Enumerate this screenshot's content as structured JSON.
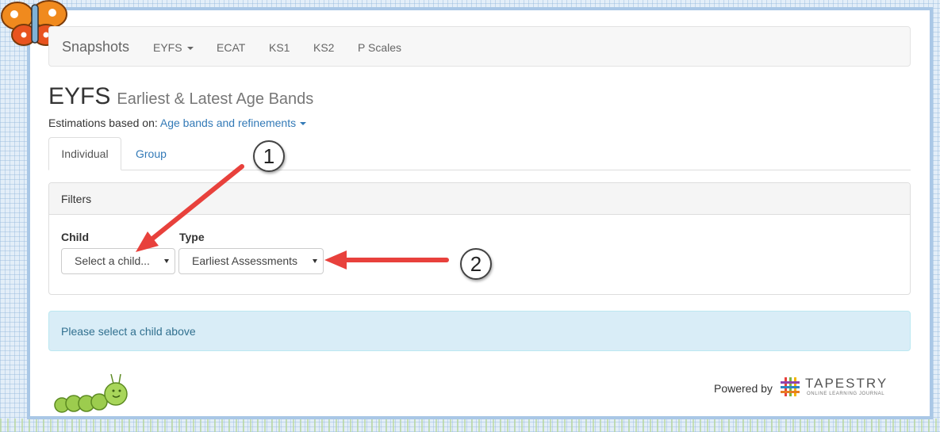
{
  "navbar": {
    "brand": "Snapshots",
    "items": [
      {
        "label": "EYFS",
        "dropdown": true
      },
      {
        "label": "ECAT"
      },
      {
        "label": "KS1"
      },
      {
        "label": "KS2"
      },
      {
        "label": "P Scales"
      }
    ]
  },
  "header": {
    "title": "EYFS",
    "subtitle": "Earliest & Latest Age Bands"
  },
  "estimations": {
    "label": "Estimations based on:",
    "value": "Age bands and refinements"
  },
  "tabs": [
    {
      "label": "Individual",
      "active": true
    },
    {
      "label": "Group",
      "active": false
    }
  ],
  "filters": {
    "title": "Filters",
    "child_label": "Child",
    "child_value": "Select a child...",
    "type_label": "Type",
    "type_value": "Earliest Assessments"
  },
  "alert": {
    "text": "Please select a child above"
  },
  "footer": {
    "powered_by": "Powered by",
    "brand": "TAPESTRY",
    "tagline": "ONLINE LEARNING JOURNAL"
  },
  "annotations": [
    {
      "number": "1"
    },
    {
      "number": "2"
    }
  ],
  "colors": {
    "link": "#337ab7",
    "alert_bg": "#d9edf7",
    "arrow": "#e8413c",
    "frame": "#a9c7e6"
  }
}
